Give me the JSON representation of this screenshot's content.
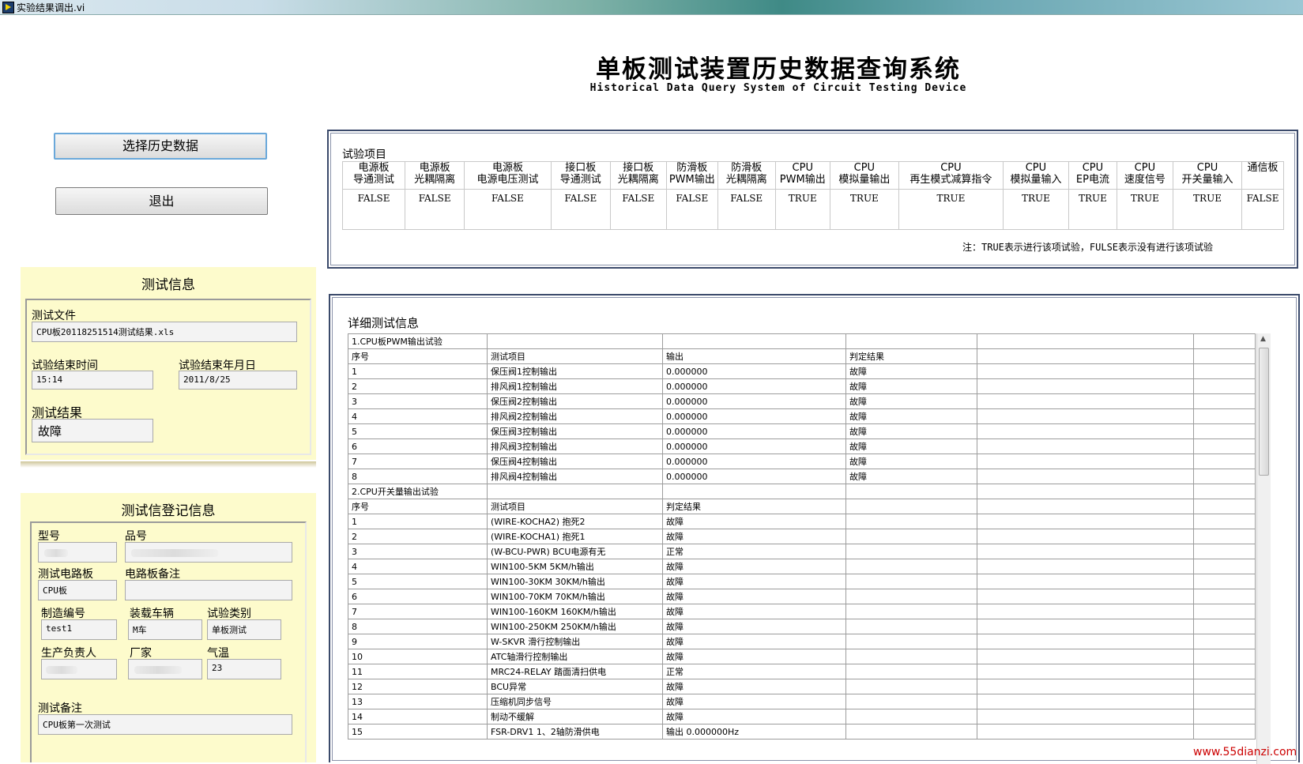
{
  "window": {
    "title": "实验结果调出.vi"
  },
  "header": {
    "title": "单板测试装置历史数据查询系统",
    "subtitle": "Historical Data Query System of Circuit Testing Device"
  },
  "buttons": {
    "select": "选择历史数据",
    "exit": "退出"
  },
  "test_info": {
    "title": "测试信息",
    "file_label": "测试文件",
    "file_value": "CPU板20118251514测试结果.xls",
    "end_time_label": "试验结束时间",
    "end_time_value": "15:14",
    "end_date_label": "试验结束年月日",
    "end_date_value": "2011/8/25",
    "result_label": "测试结果",
    "result_value": "故障"
  },
  "register_info": {
    "title": "测试信登记信息",
    "model_label": "型号",
    "model_value": "",
    "product_label": "品号",
    "product_value": "",
    "board_label": "测试电路板",
    "board_value": "CPU板",
    "board_note_label": "电路板备注",
    "board_note_value": "",
    "serial_label": "制造编号",
    "serial_value": "test1",
    "vehicle_label": "装载车辆",
    "vehicle_value": "M车",
    "type_label": "试验类别",
    "type_value": "单板测试",
    "person_label": "生产负责人",
    "person_value": "",
    "factory_label": "厂家",
    "factory_value": "",
    "temp_label": "气温",
    "temp_value": "23",
    "remark_label": "测试备注",
    "remark_value": "CPU板第一次测试"
  },
  "items": {
    "caption": "试验项目",
    "columns": [
      {
        "l1": "电源板",
        "l2": "导通测试",
        "value": "FALSE"
      },
      {
        "l1": "电源板",
        "l2": "光耦隔离",
        "value": "FALSE"
      },
      {
        "l1": "电源板",
        "l2": "电源电压测试",
        "value": "FALSE"
      },
      {
        "l1": "接口板",
        "l2": "导通测试",
        "value": "FALSE"
      },
      {
        "l1": "接口板",
        "l2": "光耦隔离",
        "value": "FALSE"
      },
      {
        "l1": "防滑板",
        "l2": "PWM输出",
        "value": "FALSE"
      },
      {
        "l1": "防滑板",
        "l2": "光耦隔离",
        "value": "FALSE"
      },
      {
        "l1": "CPU",
        "l2": "PWM输出",
        "value": "TRUE"
      },
      {
        "l1": "CPU",
        "l2": "模拟量输出",
        "value": "TRUE"
      },
      {
        "l1": "CPU",
        "l2": "再生模式减算指令",
        "value": "TRUE"
      },
      {
        "l1": "CPU",
        "l2": "模拟量输入",
        "value": "TRUE"
      },
      {
        "l1": "CPU",
        "l2": "EP电流",
        "value": "TRUE"
      },
      {
        "l1": "CPU",
        "l2": "速度信号",
        "value": "TRUE"
      },
      {
        "l1": "CPU",
        "l2": "开关量输入",
        "value": "TRUE"
      },
      {
        "l1": "通信板",
        "l2": "",
        "value": "FALSE"
      }
    ],
    "note": "注：TRUE表示进行该项试验，FULSE表示没有进行该项试验"
  },
  "detail": {
    "caption": "详细测试信息",
    "rows": [
      [
        "1.CPU板PWM输出试验",
        "",
        "",
        "",
        "",
        ""
      ],
      [
        "序号",
        "测试项目",
        "输出",
        "判定结果",
        "",
        ""
      ],
      [
        "1",
        "保压阀1控制输出",
        "0.000000",
        "故障",
        "",
        ""
      ],
      [
        "2",
        "排风阀1控制输出",
        "0.000000",
        "故障",
        "",
        ""
      ],
      [
        "3",
        "保压阀2控制输出",
        "0.000000",
        "故障",
        "",
        ""
      ],
      [
        "4",
        "排风阀2控制输出",
        "0.000000",
        "故障",
        "",
        ""
      ],
      [
        "5",
        "保压阀3控制输出",
        "0.000000",
        "故障",
        "",
        ""
      ],
      [
        "6",
        "排风阀3控制输出",
        "0.000000",
        "故障",
        "",
        ""
      ],
      [
        "7",
        "保压阀4控制输出",
        "0.000000",
        "故障",
        "",
        ""
      ],
      [
        "8",
        "排风阀4控制输出",
        "0.000000",
        "故障",
        "",
        ""
      ],
      [
        "2.CPU开关量输出试验",
        "",
        "",
        "",
        "",
        ""
      ],
      [
        "序号",
        "测试项目",
        "判定结果",
        "",
        "",
        ""
      ],
      [
        "1",
        "(WIRE-KOCHA2) 抱死2",
        "故障",
        "",
        "",
        ""
      ],
      [
        "2",
        "(WIRE-KOCHA1) 抱死1",
        "故障",
        "",
        "",
        ""
      ],
      [
        "3",
        "(W-BCU-PWR) BCU电源有无",
        "正常",
        "",
        "",
        ""
      ],
      [
        "4",
        "WIN100-5KM  5KM/h输出",
        "故障",
        "",
        "",
        ""
      ],
      [
        "5",
        "WIN100-30KM  30KM/h输出",
        "故障",
        "",
        "",
        ""
      ],
      [
        "6",
        "WIN100-70KM  70KM/h输出",
        "故障",
        "",
        "",
        ""
      ],
      [
        "7",
        "WIN100-160KM   160KM/h输出",
        "故障",
        "",
        "",
        ""
      ],
      [
        "8",
        "WIN100-250KM   250KM/h输出",
        "故障",
        "",
        "",
        ""
      ],
      [
        "9",
        "W-SKVR  滑行控制输出",
        "故障",
        "",
        "",
        ""
      ],
      [
        "10",
        "ATC轴滑行控制输出",
        "故障",
        "",
        "",
        ""
      ],
      [
        "11",
        "MRC24-RELAY  踏面清扫供电",
        "正常",
        "",
        "",
        ""
      ],
      [
        "12",
        "BCU异常",
        "故障",
        "",
        "",
        ""
      ],
      [
        "13",
        "压缩机同步信号",
        "故障",
        "",
        "",
        ""
      ],
      [
        "14",
        "制动不缓解",
        "故障",
        "",
        "",
        ""
      ],
      [
        "15",
        "FSR-DRV1  1、2轴防滑供电",
        "输出  0.000000Hz",
        "",
        "",
        ""
      ]
    ]
  },
  "watermark": "www.55dianzi.com",
  "colors": {
    "panel_bg": "#fdfbcc",
    "frame_border": "#3b4a6b"
  }
}
